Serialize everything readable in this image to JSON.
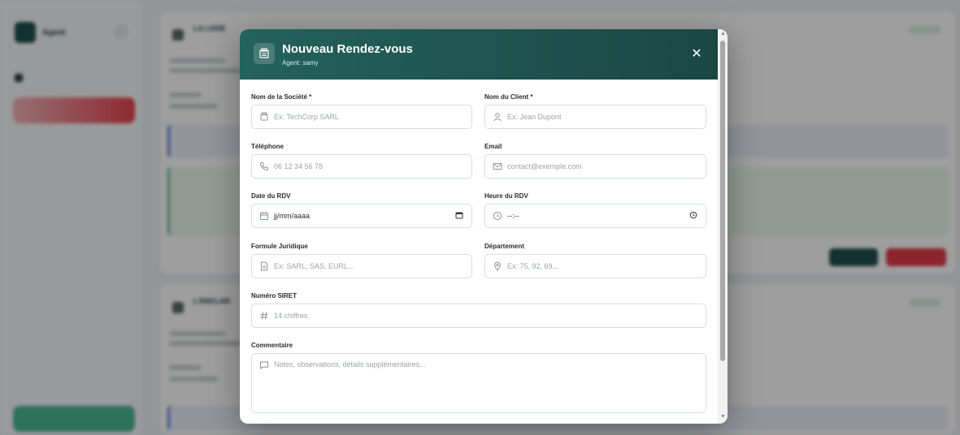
{
  "background": {
    "sidebar": {
      "title": "Agent",
      "subtitle": "",
      "nav_item": "",
      "active_item": "",
      "bottom_button": ""
    },
    "cards": [
      {
        "title": "LA LOGE",
        "subtitle": ""
      },
      {
        "title": "L'ENCLAR",
        "subtitle": ""
      }
    ]
  },
  "modal": {
    "title": "Nouveau Rendez-vous",
    "agent_line": "Agent: samy",
    "close_symbol": "✕",
    "fields": {
      "societe": {
        "label": "Nom de la Société *",
        "placeholder": "Ex: TechCorp SARL",
        "icon": "building-icon"
      },
      "client": {
        "label": "Nom du Client *",
        "placeholder": "Ex: Jean Dupont",
        "icon": "user-icon"
      },
      "telephone": {
        "label": "Téléphone",
        "placeholder": "06 12 34 56 78",
        "icon": "phone-icon"
      },
      "email": {
        "label": "Email",
        "placeholder": "contact@exemple.com",
        "icon": "mail-icon"
      },
      "date": {
        "label": "Date du RDV",
        "value": "jj/mm/aaaa",
        "icon": "calendar-icon"
      },
      "heure": {
        "label": "Heure du RDV",
        "value": "--:--",
        "icon": "clock-icon"
      },
      "formule": {
        "label": "Formule Juridique",
        "placeholder": "Ex: SARL, SAS, EURL...",
        "icon": "document-icon"
      },
      "departement": {
        "label": "Département",
        "placeholder": "Ex: 75, 92, 69...",
        "icon": "location-pin-icon"
      },
      "siret": {
        "label": "Numéro SIRET",
        "placeholder": "14 chiffres",
        "icon": "hash-icon"
      },
      "commentaire": {
        "label": "Commentaire",
        "placeholder": "Notes, observations, détails supplémentaires...",
        "icon": "comment-icon"
      }
    }
  },
  "colors": {
    "header_start": "#24625c",
    "header_end": "#1a4744",
    "danger": "#e03b46",
    "success": "#4cb893"
  }
}
